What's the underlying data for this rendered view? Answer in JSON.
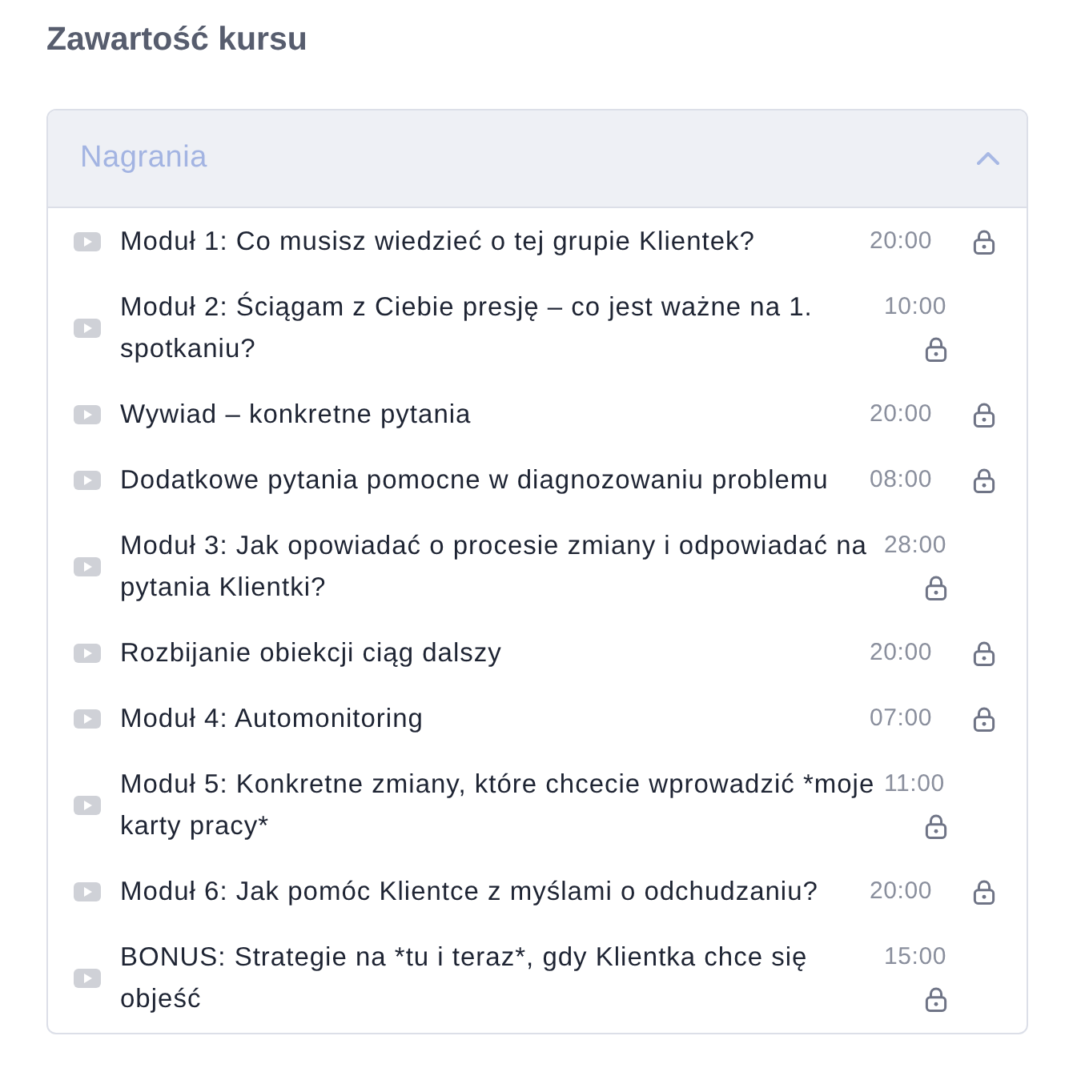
{
  "title": "Zawartość kursu",
  "section": {
    "title": "Nagrania",
    "expanded": true,
    "lessons": [
      {
        "title": "Moduł 1: Co musisz wiedzieć o tej grupie Klientek?",
        "duration": "20:00",
        "locked": true
      },
      {
        "title": "Moduł 2: Ściągam z Ciebie presję – co jest ważne na 1. spotkaniu?",
        "duration": "10:00",
        "locked": true
      },
      {
        "title": "Wywiad – konkretne pytania",
        "duration": "20:00",
        "locked": true
      },
      {
        "title": "Dodatkowe pytania pomocne w diagnozowaniu problemu",
        "duration": "08:00",
        "locked": true
      },
      {
        "title": "Moduł 3: Jak opowiadać o procesie zmiany i odpowiadać na pytania Klientki?",
        "duration": "28:00",
        "locked": true
      },
      {
        "title": "Rozbijanie obiekcji ciąg dalszy",
        "duration": "20:00",
        "locked": true
      },
      {
        "title": "Moduł 4: Automonitoring",
        "duration": "07:00",
        "locked": true
      },
      {
        "title": "Moduł 5: Konkretne zmiany, które chcecie wprowadzić *moje karty pracy*",
        "duration": "11:00",
        "locked": true
      },
      {
        "title": "Moduł 6: Jak pomóc Klientce z myślami o odchudzaniu?",
        "duration": "20:00",
        "locked": true
      },
      {
        "title": "BONUS: Strategie na *tu i teraz*, gdy Klientka chce się objeść",
        "duration": "15:00",
        "locked": true
      }
    ]
  }
}
